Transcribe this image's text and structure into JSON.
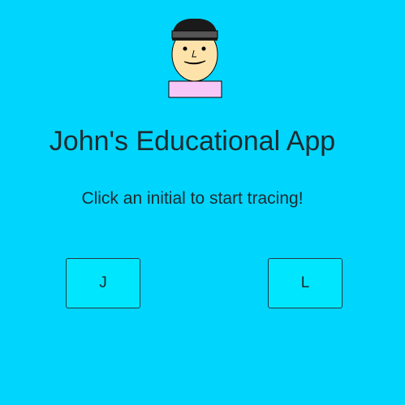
{
  "header": {
    "avatar_icon": "boy-face-avatar-icon",
    "title": "John's Educational App",
    "instructions": "Click an initial to start tracing!"
  },
  "initials": [
    {
      "label": "J"
    },
    {
      "label": "L"
    }
  ],
  "colors": {
    "background": "#00d5fd",
    "button_fill": "#00e6ff",
    "text": "#1d2b30",
    "avatar_hair": "#1a1a1a",
    "avatar_headband": "#555555",
    "avatar_skin": "#fde3aa",
    "avatar_shirt": "#f7c8f7"
  }
}
